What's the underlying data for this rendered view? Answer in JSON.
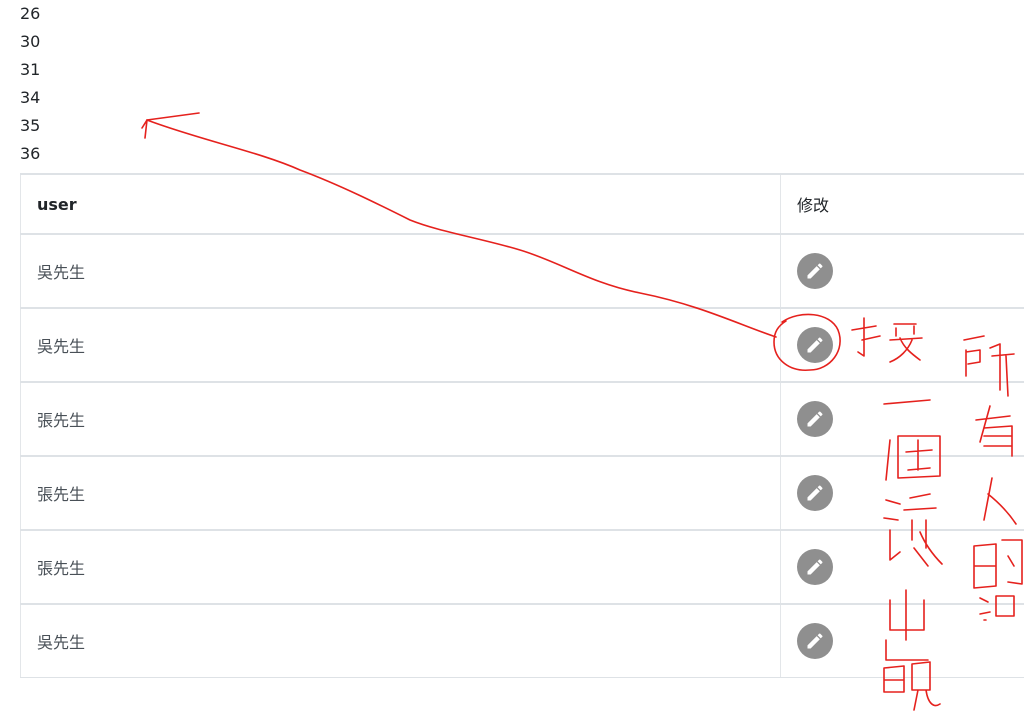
{
  "id_list": [
    "26",
    "30",
    "31",
    "34",
    "35",
    "36"
  ],
  "table": {
    "headers": {
      "user": "user",
      "edit": "修改"
    },
    "rows": [
      {
        "user": "吳先生",
        "edit_icon": "pencil-icon"
      },
      {
        "user": "吳先生",
        "edit_icon": "pencil-icon"
      },
      {
        "user": "張先生",
        "edit_icon": "pencil-icon"
      },
      {
        "user": "張先生",
        "edit_icon": "pencil-icon"
      },
      {
        "user": "張先生",
        "edit_icon": "pencil-icon"
      },
      {
        "user": "吳先生",
        "edit_icon": "pencil-icon"
      }
    ]
  },
  "colors": {
    "edit_button": "#8f8f8f",
    "annotation": "#e5211d"
  }
}
